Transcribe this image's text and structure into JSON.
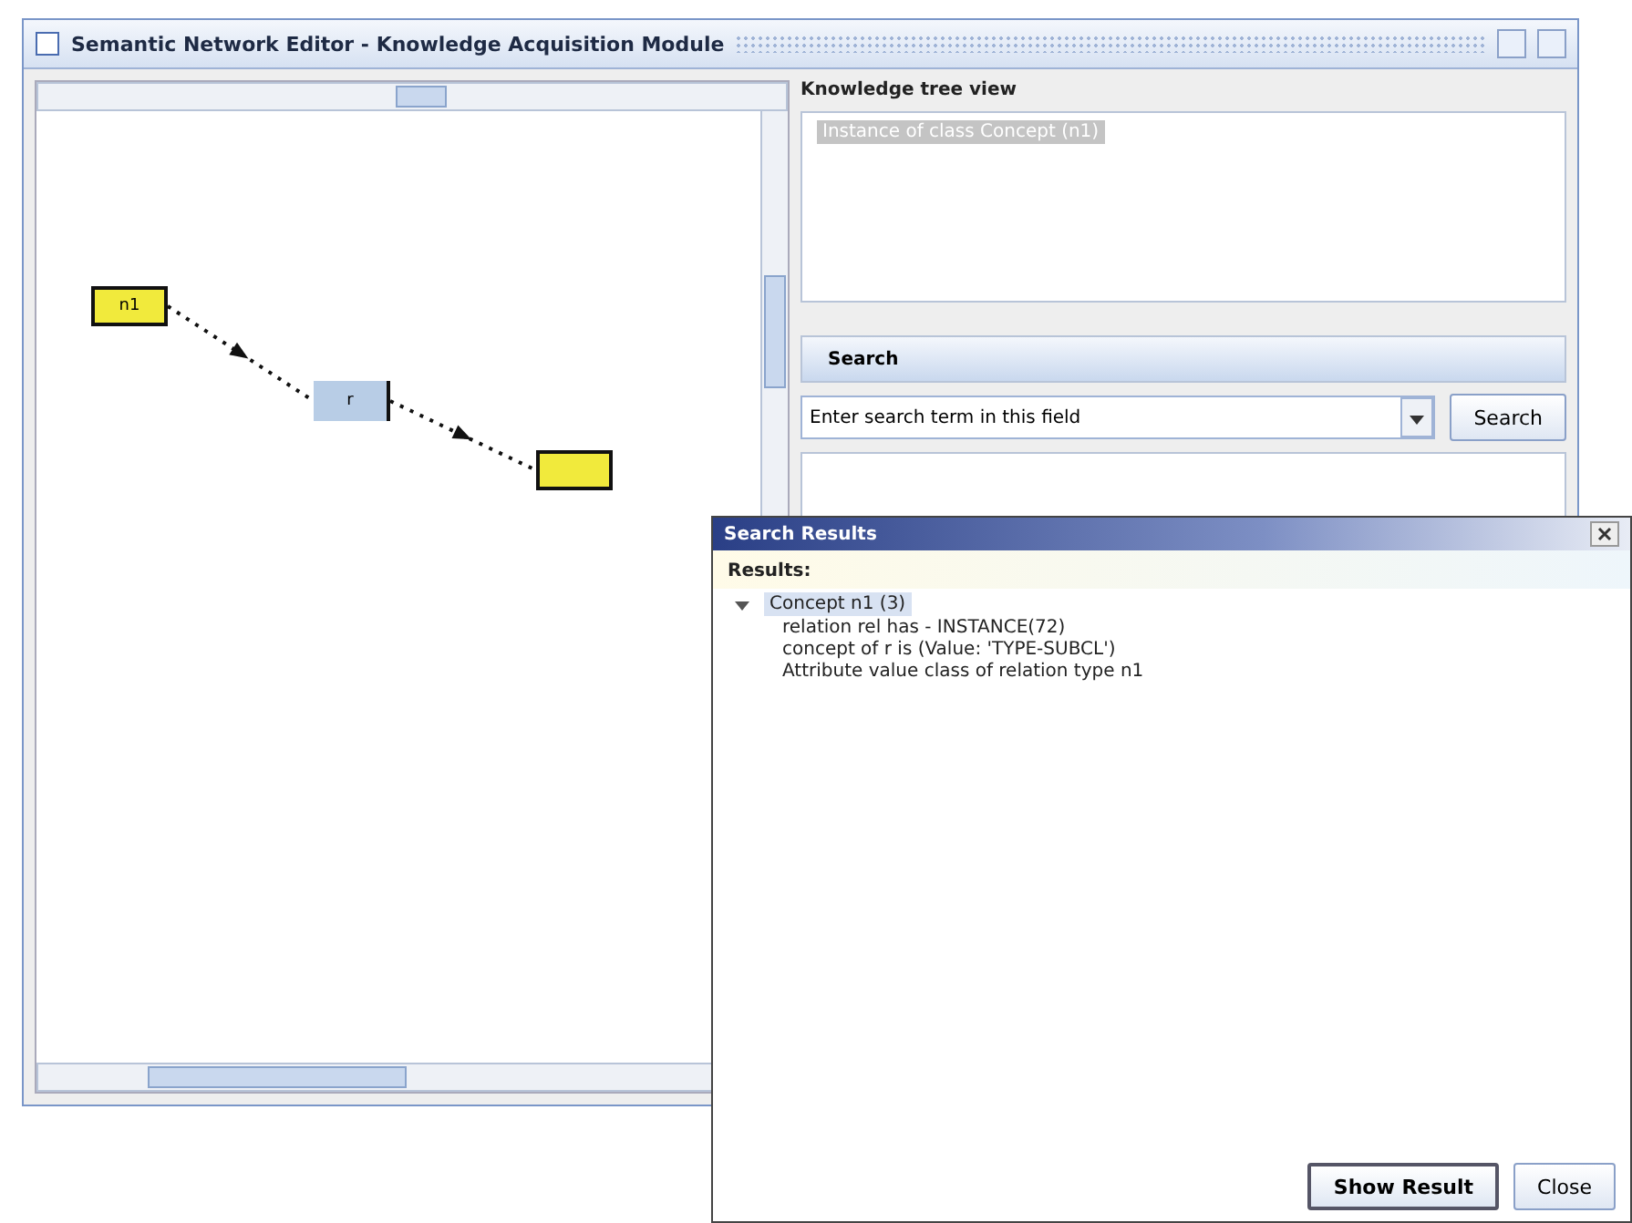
{
  "main_window": {
    "title": "Semantic Network Editor - Knowledge Acquisition Module"
  },
  "diagram": {
    "nodes": [
      {
        "label": "n1",
        "kind": "concept"
      },
      {
        "label": "r",
        "kind": "relation"
      },
      {
        "kind": "concept"
      }
    ]
  },
  "tree_panel": {
    "title": "Knowledge tree view",
    "items": [
      {
        "label": "Instance of class Concept (n1)",
        "selected": true
      }
    ]
  },
  "search_panel": {
    "title": "Search",
    "query": "Enter search term in this field",
    "button": "Search"
  },
  "dialog": {
    "title": "Search Results",
    "label": "Results:",
    "tree": [
      {
        "label": "Concept n1 (3)",
        "expanded": true,
        "selected": true,
        "children": [
          {
            "label": "relation   rel  has - INSTANCE(72)"
          },
          {
            "label": "concept of r  is (Value: 'TYPE-SUBCL')"
          },
          {
            "label": "Attribute value class of relation type n1"
          }
        ]
      }
    ],
    "buttons": [
      {
        "label": "Show Result",
        "default": true
      },
      {
        "label": "Close",
        "default": false
      }
    ]
  }
}
